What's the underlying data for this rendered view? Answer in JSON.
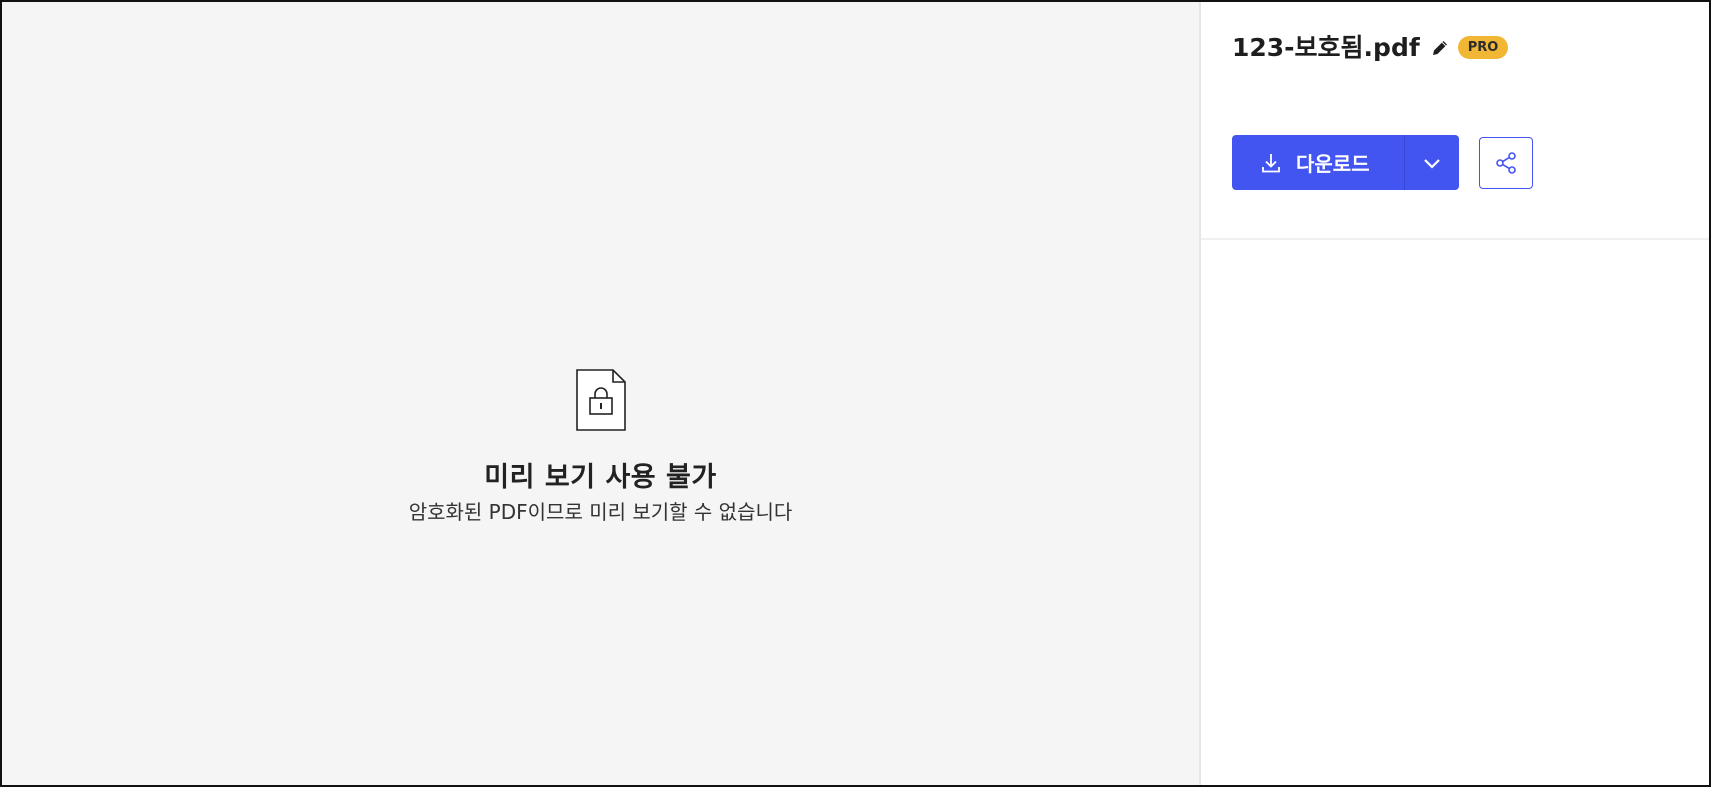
{
  "preview": {
    "icon": "locked-document-icon",
    "title": "미리 보기 사용 불가",
    "subtitle": "암호화된 PDF이므로 미리 보기할 수 없습니다"
  },
  "file": {
    "name": "123-보호됨.pdf",
    "edit_icon": "pencil-icon",
    "badge": "PRO"
  },
  "actions": {
    "download_label": "다운로드",
    "download_icon": "download-icon",
    "dropdown_icon": "chevron-down-icon",
    "share_icon": "share-icon"
  },
  "colors": {
    "primary": "#4355f0",
    "badge": "#f1b734",
    "preview_bg": "#f5f5f5"
  }
}
